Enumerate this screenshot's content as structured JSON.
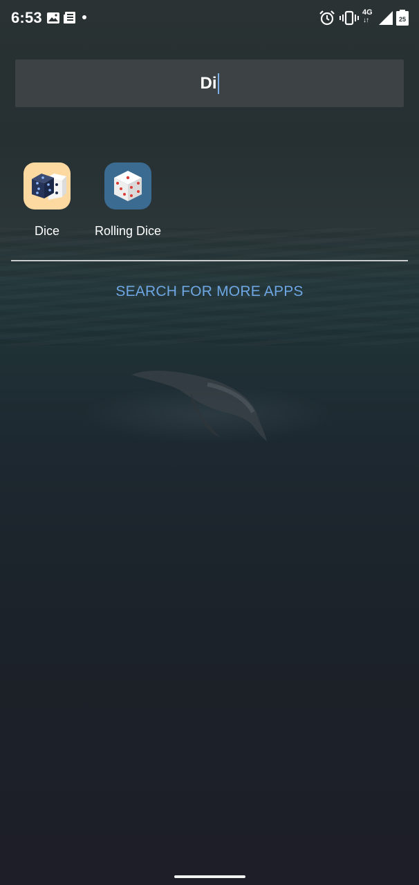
{
  "status_bar": {
    "time": "6:53",
    "network": "4G",
    "network_arrows": "↓↑",
    "battery_level": "25",
    "icons": [
      "image-icon",
      "news-icon",
      "notification-dot",
      "alarm-icon",
      "vibrate-icon",
      "signal-icon",
      "battery-icon"
    ]
  },
  "search": {
    "value": "Di"
  },
  "results": [
    {
      "label": "Dice",
      "icon": "dice-app-icon",
      "icon_bg": "#fcd9a0"
    },
    {
      "label": "Rolling Dice",
      "icon": "rolling-dice-app-icon",
      "icon_bg": "#3b6b91"
    }
  ],
  "more_apps_label": "SEARCH FOR MORE APPS",
  "colors": {
    "accent": "#6ea6e4",
    "search_bg": "#3d4244"
  }
}
